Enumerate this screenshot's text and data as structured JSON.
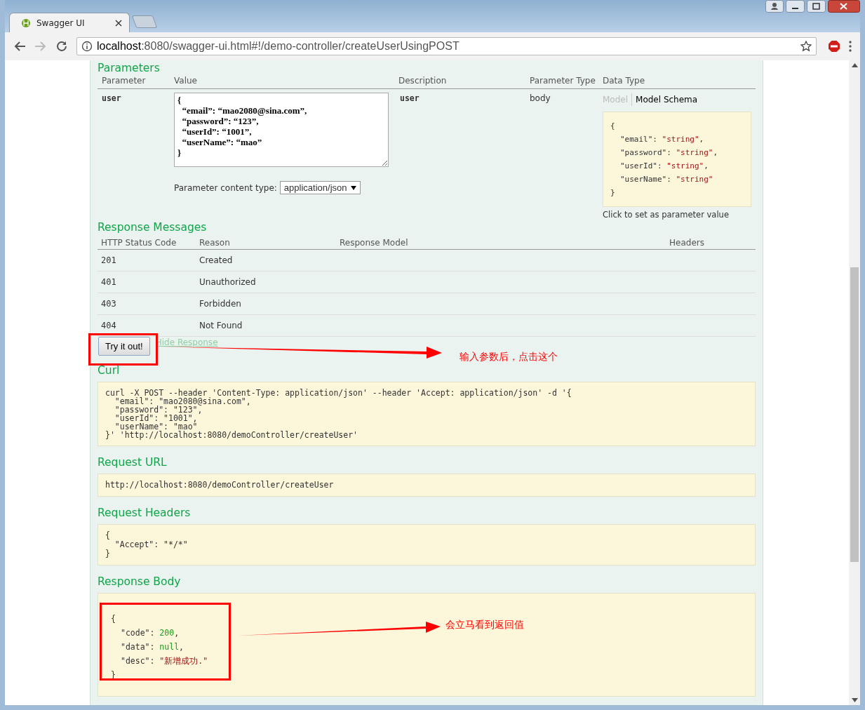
{
  "window": {
    "tab_title": "Swagger UI",
    "address": {
      "host": "localhost",
      "rest": ":8080/swagger-ui.html#!/demo-controller/createUserUsingPOST"
    }
  },
  "parameters": {
    "title": "Parameters",
    "columns": [
      "Parameter",
      "Value",
      "Description",
      "Parameter Type",
      "Data Type"
    ],
    "rows": [
      {
        "name": "user",
        "value": "{\n  “email”: “mao2080@sina.com”,\n  “password”: “123”,\n  “userId”: “1001”,\n  “userName”: “mao”\n}",
        "description": "user",
        "type": "body",
        "model_tabs": [
          {
            "label": "Model",
            "selected": false
          },
          {
            "label": "Model Schema",
            "selected": true
          }
        ],
        "schema": {
          "open": "{",
          "fields": [
            {
              "key": "\"email\":",
              "value": "\"string\"",
              "sep": ","
            },
            {
              "key": "\"password\":",
              "value": "\"string\"",
              "sep": ","
            },
            {
              "key": "\"userId\":",
              "value": "\"string\"",
              "sep": ","
            },
            {
              "key": "\"userName\":",
              "value": "\"string\""
            }
          ],
          "close": "}"
        },
        "schema_hint": "Click to set as parameter value",
        "content_type_label": "Parameter content type:",
        "content_type": "application/json"
      }
    ]
  },
  "responses": {
    "title": "Response Messages",
    "columns": [
      "HTTP Status Code",
      "Reason",
      "Response Model",
      "Headers"
    ],
    "rows": [
      {
        "code": "201",
        "reason": "Created"
      },
      {
        "code": "401",
        "reason": "Unauthorized"
      },
      {
        "code": "403",
        "reason": "Forbidden"
      },
      {
        "code": "404",
        "reason": "Not Found"
      }
    ]
  },
  "try_button": "Try it out!",
  "hide_link": "Hide Response",
  "curl": {
    "title": "Curl",
    "lines": [
      "curl -X POST --header 'Content-Type: application/json' --header 'Accept: application/json' -d '{",
      "  \"email\": \"mao2080@sina.com\",",
      "  \"password\": \"123\",",
      "  \"userId\": \"1001\",",
      "  \"userName\": \"mao\"",
      "}' 'http://localhost:8080/demoController/createUser'"
    ]
  },
  "request_url": {
    "title": "Request URL",
    "value": "http://localhost:8080/demoController/createUser"
  },
  "request_headers": {
    "title": "Request Headers",
    "lines": [
      "{",
      "  \"Accept\": \"*/*\"",
      "}"
    ]
  },
  "response_body": {
    "title": "Response Body",
    "open": "{",
    "fields": [
      {
        "key": "\"code\":",
        "value": "200",
        "kind": "number",
        "sep": ","
      },
      {
        "key": "\"data\":",
        "value": "null",
        "kind": "null",
        "sep": ","
      },
      {
        "key": "\"desc\":",
        "value": "\"新增成功.\"",
        "kind": "string"
      }
    ],
    "close": "}"
  },
  "annotations": [
    {
      "text": "输入参数后，点击这个"
    },
    {
      "text": "会立马看到返回值"
    }
  ]
}
